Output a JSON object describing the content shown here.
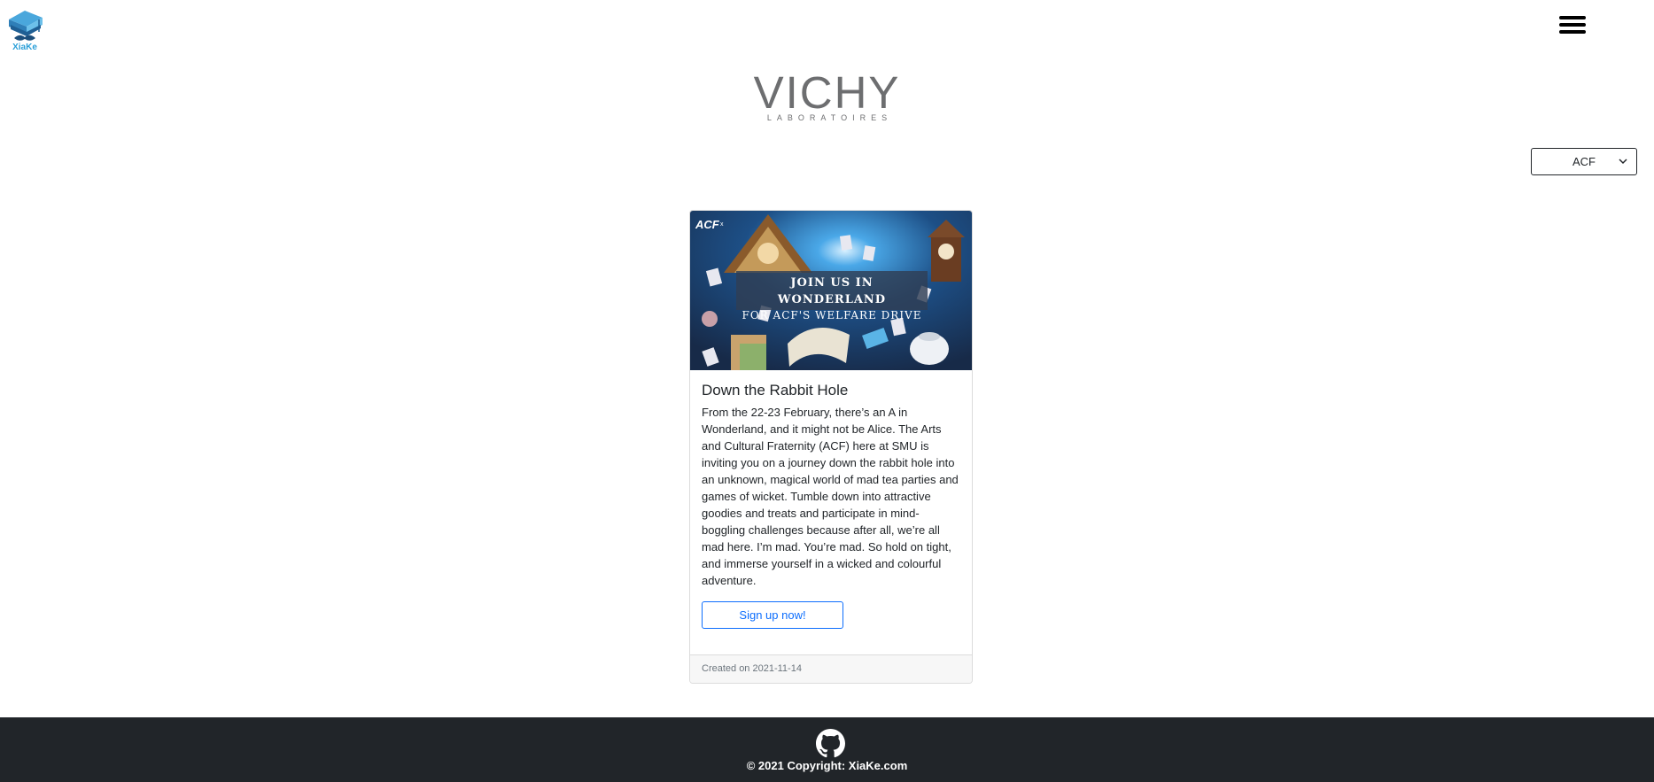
{
  "header": {
    "logo_icon": "graduation-cap-mustache-icon",
    "logo_text": "XiaKe",
    "menu_icon": "hamburger-menu-icon"
  },
  "brand": {
    "name": "VICHY",
    "subtitle": "LABORATOIRES"
  },
  "filter": {
    "selected": "ACF",
    "icon": "chevron-down-icon"
  },
  "card": {
    "image": {
      "logo": "ACF",
      "line1": "JOIN US IN WONDERLAND",
      "line2": "FOR ACF'S WELFARE DRIVE"
    },
    "title": "Down the Rabbit Hole",
    "text": "From the 22-23 February, there’s an A in Wonderland, and it might not be Alice. The Arts and Cultural Fraternity (ACF) here at SMU is inviting you on a journey down the rabbit hole into an unknown, magical world of mad tea parties and games of wicket. Tumble down into attractive goodies and treats and participate in mind-boggling challenges because after all, we’re all mad here. I’m mad. You’re mad. So hold on tight, and immerse yourself in a wicked and colourful adventure.",
    "button": "Sign up now!",
    "footer": "Created on 2021-11-14"
  },
  "footer": {
    "icon": "github-icon",
    "copyright": "© 2021 Copyright: XiaKe.com"
  },
  "colors": {
    "accent": "#0d6efd",
    "footer_bg": "#212529",
    "brand_gray": "#6d6e70"
  }
}
